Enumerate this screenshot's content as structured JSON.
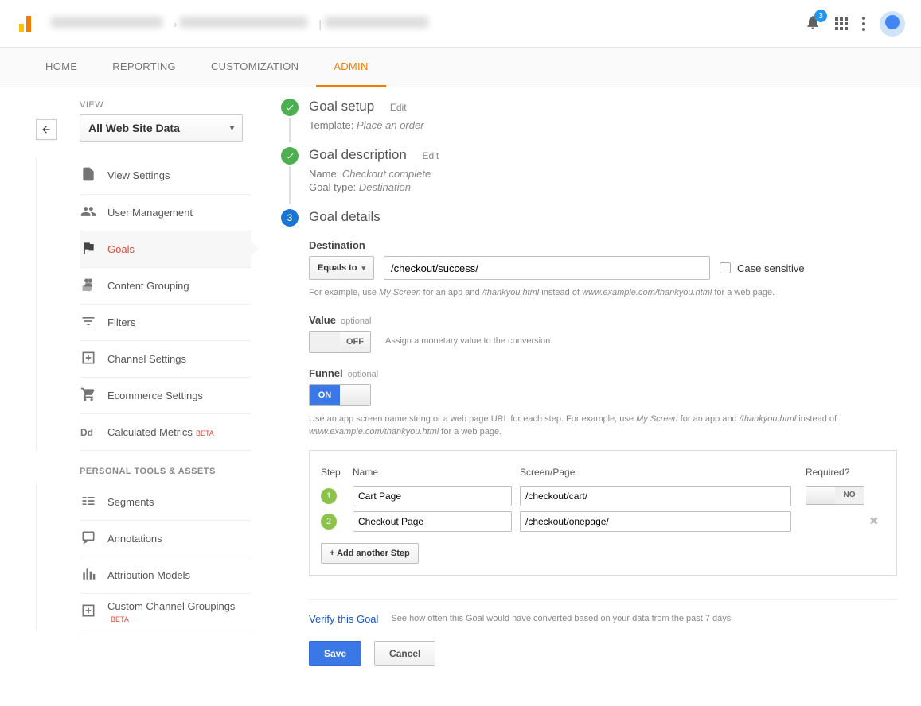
{
  "header": {
    "notification_count": "3"
  },
  "tabs": [
    "HOME",
    "REPORTING",
    "CUSTOMIZATION",
    "ADMIN"
  ],
  "sidebar": {
    "view_label": "VIEW",
    "view_value": "All Web Site Data",
    "items": [
      {
        "label": "View Settings"
      },
      {
        "label": "User Management"
      },
      {
        "label": "Goals"
      },
      {
        "label": "Content Grouping"
      },
      {
        "label": "Filters"
      },
      {
        "label": "Channel Settings"
      },
      {
        "label": "Ecommerce Settings"
      },
      {
        "label": "Calculated Metrics",
        "beta": "BETA"
      }
    ],
    "section2_label": "PERSONAL TOOLS & ASSETS",
    "section2_items": [
      {
        "label": "Segments"
      },
      {
        "label": "Annotations"
      },
      {
        "label": "Attribution Models"
      },
      {
        "label": "Custom Channel Groupings",
        "beta": "BETA"
      }
    ]
  },
  "steps": {
    "setup": {
      "title": "Goal setup",
      "edit": "Edit",
      "template_label": "Template:",
      "template_value": "Place an order"
    },
    "description": {
      "title": "Goal description",
      "edit": "Edit",
      "name_label": "Name:",
      "name_value": "Checkout complete",
      "type_label": "Goal type:",
      "type_value": "Destination"
    },
    "details": {
      "number": "3",
      "title": "Goal details"
    }
  },
  "destination": {
    "label": "Destination",
    "match_type": "Equals to",
    "value": "/checkout/success/",
    "case_sensitive_label": "Case sensitive",
    "hint_pre": "For example, use ",
    "hint_i1": "My Screen",
    "hint_mid1": " for an app and ",
    "hint_i2": "/thankyou.html",
    "hint_mid2": " instead of ",
    "hint_i3": "www.example.com/thankyou.html",
    "hint_post": " for a web page."
  },
  "value": {
    "label": "Value",
    "optional": "optional",
    "toggle": "OFF",
    "hint": "Assign a monetary value to the conversion."
  },
  "funnel": {
    "label": "Funnel",
    "optional": "optional",
    "toggle": "ON",
    "hint_pre": "Use an app screen name string or a web page URL for each step. For example, use ",
    "hint_i1": "My Screen",
    "hint_mid1": " for an app and ",
    "hint_i2": "/thankyou.html",
    "hint_mid2": " instead of ",
    "hint_i3": "www.example.com/thankyou.html",
    "hint_post": " for a web page.",
    "col_step": "Step",
    "col_name": "Name",
    "col_page": "Screen/Page",
    "col_required": "Required?",
    "steps": [
      {
        "n": "1",
        "name": "Cart Page",
        "page": "/checkout/cart/",
        "required": "NO"
      },
      {
        "n": "2",
        "name": "Checkout Page",
        "page": "/checkout/onepage/"
      }
    ],
    "add_btn": "+ Add another Step"
  },
  "verify": {
    "link": "Verify this Goal",
    "hint": "See how often this Goal would have converted based on your data from the past 7 days."
  },
  "buttons": {
    "save": "Save",
    "cancel": "Cancel"
  }
}
